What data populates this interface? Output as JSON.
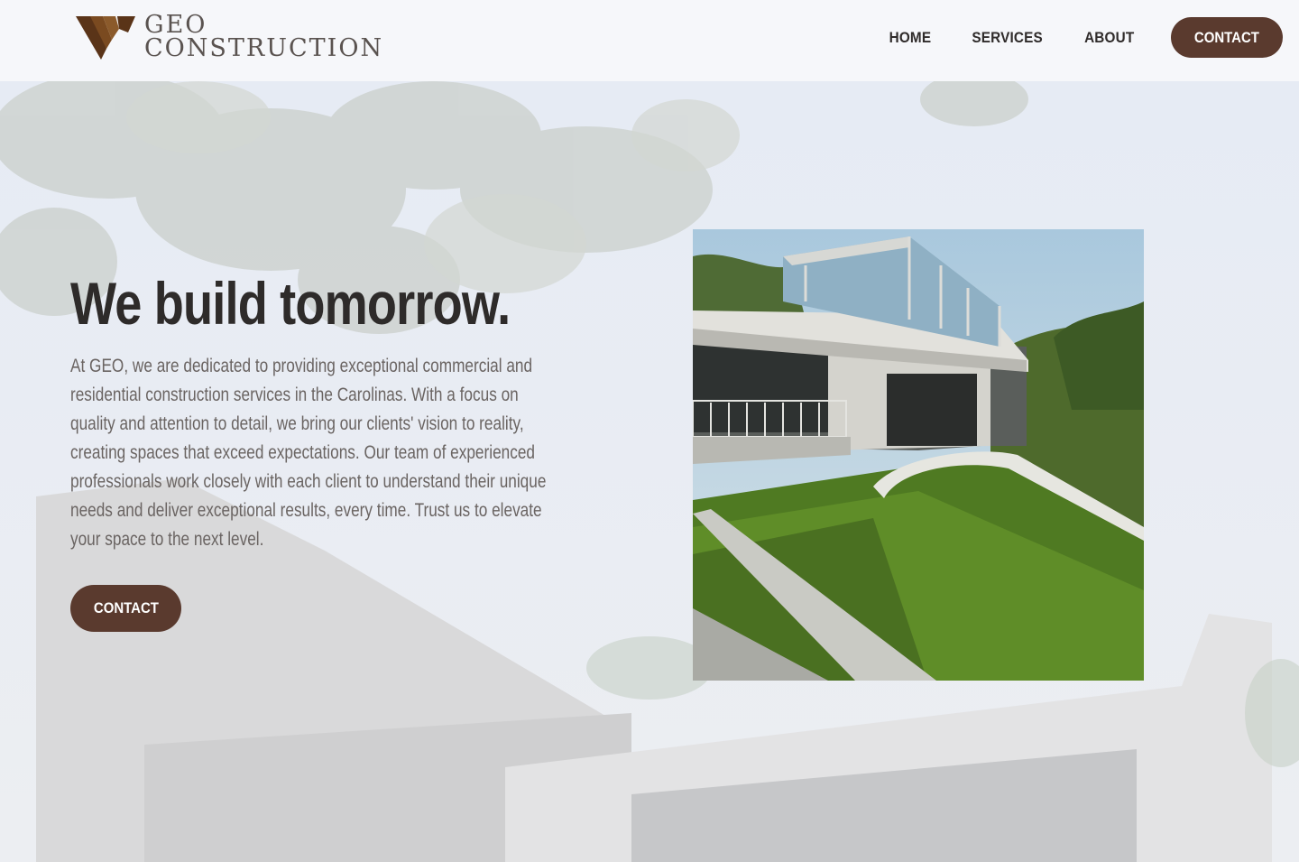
{
  "brand": {
    "line1": "GEO",
    "line2": "CONSTRUCTION",
    "logo_icon": "geo-logo-mark",
    "accent": "#5a3a2e",
    "logo_color": "#6b4520"
  },
  "nav": {
    "items": [
      {
        "label": "HOME"
      },
      {
        "label": "SERVICES"
      },
      {
        "label": "ABOUT"
      }
    ],
    "cta": "CONTACT"
  },
  "hero": {
    "title": "We build tomorrow.",
    "body": "At GEO, we are dedicated to providing exceptional commercial and residential construction services in the Carolinas. With a focus on quality and attention to detail, we bring our clients' vision to reality, creating spaces that exceed expectations. Our team of experienced professionals work closely with each client to understand their unique needs and deliver exceptional results, every time. Trust us to elevate your space to the next level.",
    "cta": "CONTACT",
    "image_icon": "modern-house-photo"
  }
}
